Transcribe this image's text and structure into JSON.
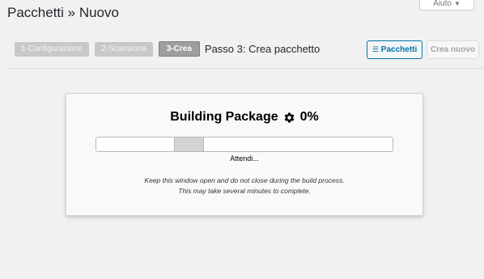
{
  "header": {
    "title": "Pacchetti » Nuovo",
    "help_label": "Aiuto",
    "help_caret": "▼"
  },
  "steps": {
    "items": [
      {
        "label": "1-Configurazione"
      },
      {
        "label": "2-Scansiona"
      },
      {
        "label": "3-Crea"
      }
    ],
    "caption": "Passo 3: Crea pacchetto"
  },
  "toolbar": {
    "packages_label": "Pacchetti",
    "packages_icon": "list-icon",
    "new_label": "Crea nuovo"
  },
  "build": {
    "title": "Building Package",
    "icon": "gear-icon",
    "percent": "0%",
    "progress_fraction": 0,
    "wait_text": "Attendi...",
    "note_line1": "Keep this window open and do not close during the build process.",
    "note_line2": "This may take several minutes to complete."
  },
  "colors": {
    "accent": "#0073aa",
    "background": "#f1f1f1"
  }
}
